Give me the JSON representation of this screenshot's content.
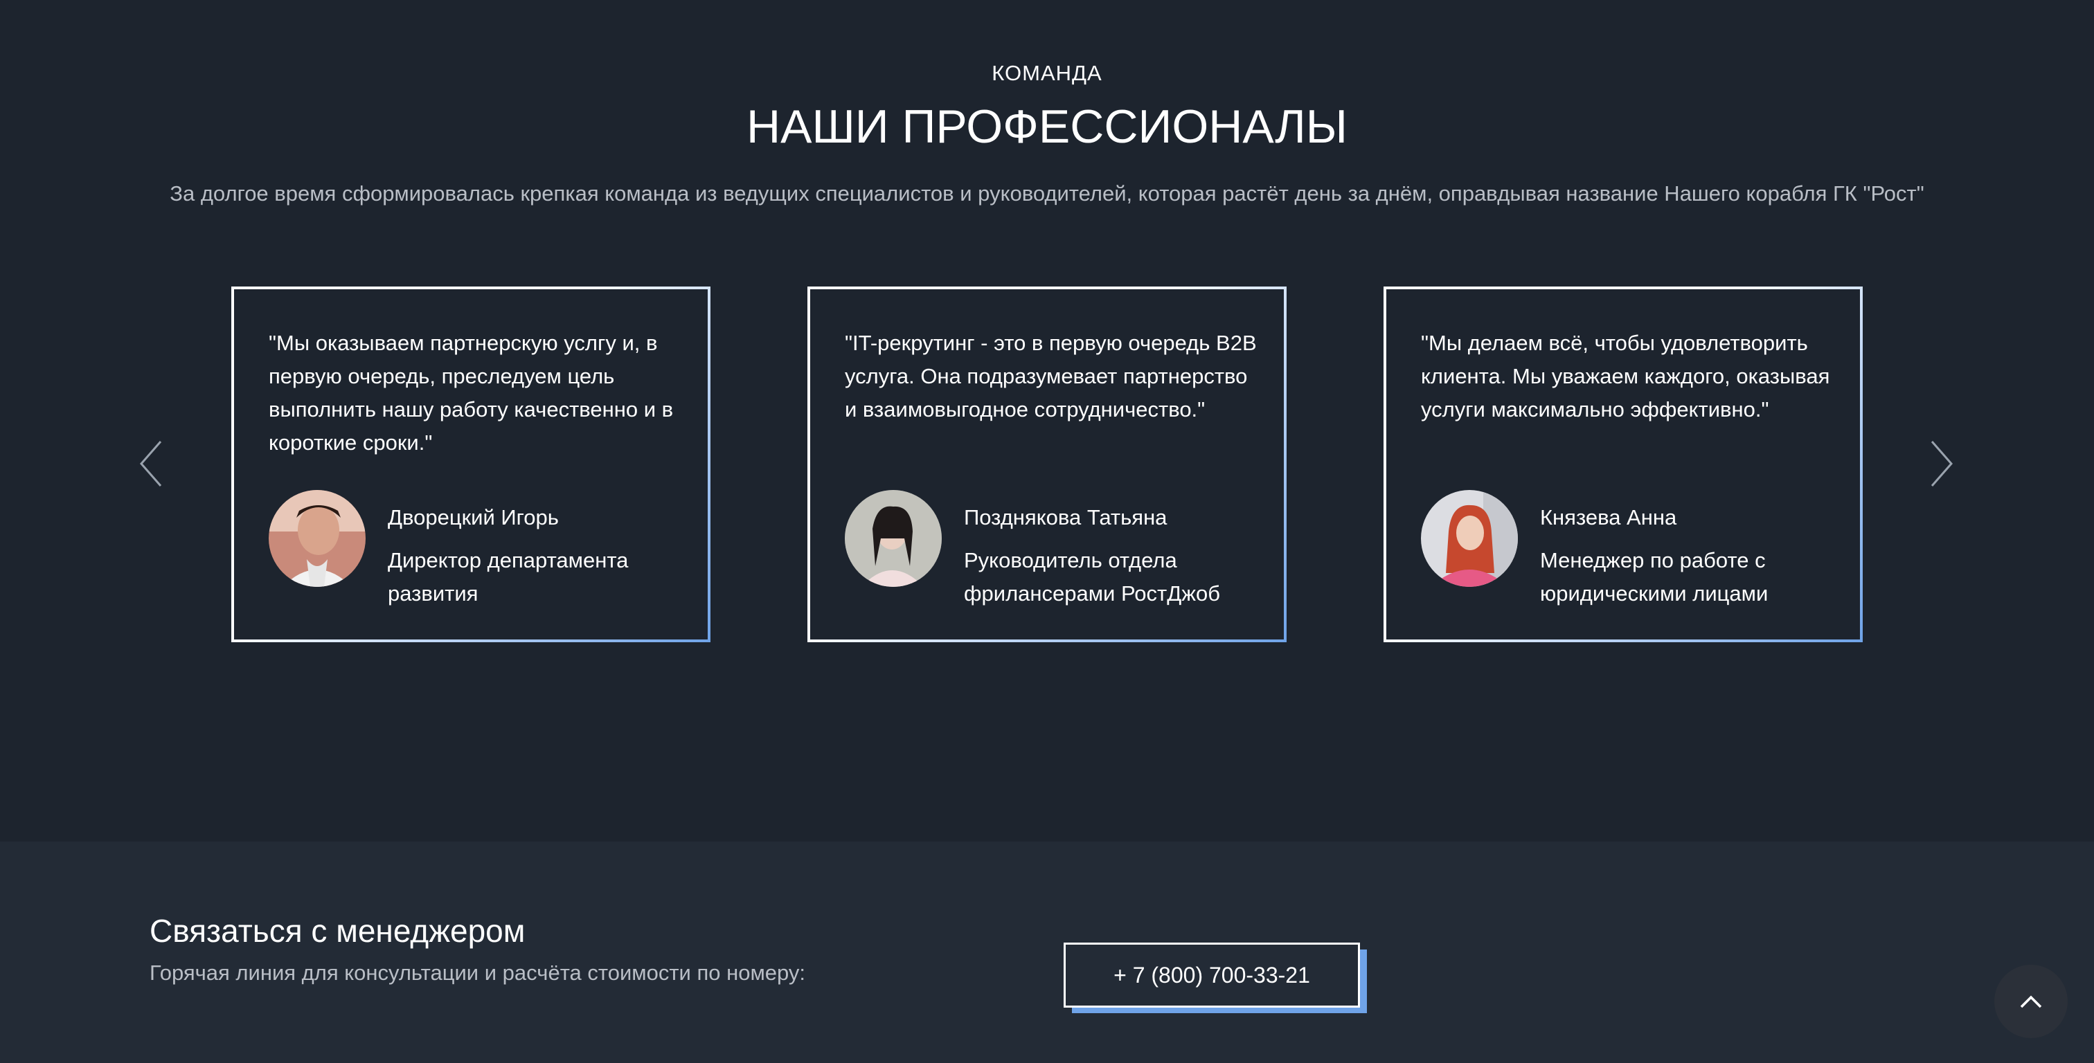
{
  "team": {
    "eyebrow": "КОМАНДА",
    "title": "НАШИ ПРОФЕССИОНАЛЫ",
    "intro": "За долгое время сформировалась крепкая команда из ведущих специалистов и руководителей, которая растёт день за днём, оправдывая название Нашего корабля ГК \"Рост\"",
    "prev_icon": "chevron-left-icon",
    "next_icon": "chevron-right-icon",
    "cards": [
      {
        "quote": "\"Мы оказываем партнерскую услгу и, в первую очередь, преследуем цель выполнить нашу работу качественно и в короткие сроки.\"",
        "name": "Дворецкий Игорь",
        "role": "Директор департамента развития"
      },
      {
        "quote": "\"IT-рекрутинг - это в первую очередь B2B услуга. Она подразумевает партнерство и взаимовыгодное сотрудничество.\"",
        "name": "Позднякова Татьяна",
        "role": "Руководитель отдела фрилансерами РостДжоб"
      },
      {
        "quote": "\"Мы делаем всё, чтобы удовлетворить клиента. Мы уважаем каждого, оказывая услуги максимально эффективно.\"",
        "name": "Князева Анна",
        "role": "Менеджер по работе с юридическими лицами"
      }
    ]
  },
  "contact": {
    "title": "Связаться с менеджером",
    "subtitle": "Горячая линия для консультации и расчёта стоимости по номеру:",
    "phone": "+ 7 (800) 700-33-21",
    "scroll_top_icon": "chevron-up-icon"
  },
  "colors": {
    "background": "#1d242e",
    "contact_background": "#232b36",
    "accent": "#6fa3e8",
    "muted_text": "#b9bec6"
  }
}
